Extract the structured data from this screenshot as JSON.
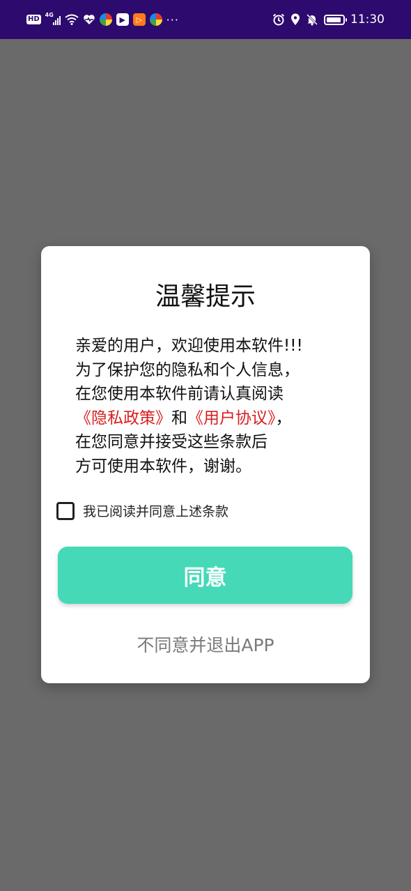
{
  "status_bar": {
    "hd": "HD",
    "network": "4G",
    "time": "11:30",
    "more": "···",
    "battery_level": 0.9,
    "icons": [
      "hd-icon",
      "signal-icon",
      "wifi-icon",
      "health-icon",
      "app-icon",
      "play-icon",
      "video-icon",
      "app-icon",
      "alarm-icon",
      "location-icon",
      "mute-icon",
      "battery-icon"
    ]
  },
  "dialog": {
    "title": "温馨提示",
    "body": {
      "line1": "亲爱的用户，欢迎使用本软件!!!",
      "line2": "为了保护您的隐私和个人信息，",
      "line3": "在您使用本软件前请认真阅读",
      "privacy_link": "《隐私政策》",
      "and_text": "和",
      "agreement_link": "《用户协议》",
      "comma": "，",
      "line5": "在您同意并接受这些条款后",
      "line6": "方可使用本软件，谢谢。"
    },
    "checkbox_label": "我已阅读并同意上述条款",
    "checkbox_checked": false,
    "agree_button": "同意",
    "exit_link": "不同意并退出APP"
  },
  "colors": {
    "status_bar_bg": "#2d0a6e",
    "overlay_bg": "#6a6a6a",
    "accent": "#45d9b8",
    "link": "#d81e1e",
    "muted_text": "#7a7a7a"
  }
}
